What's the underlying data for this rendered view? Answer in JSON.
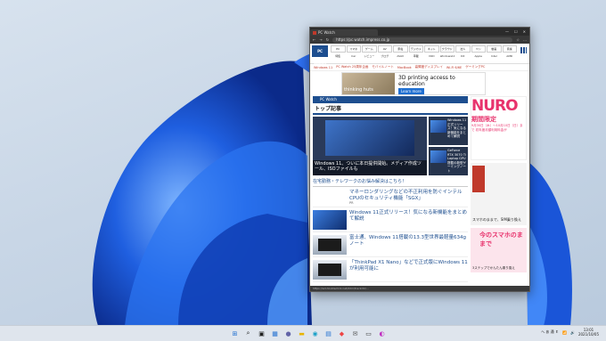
{
  "browser": {
    "tab_title": "PC Watch",
    "url": "https://pc.watch.impress.co.jp",
    "status_url": "https://ad.doubleclick.net/ddm/trackclk/…",
    "window_controls": [
      "—",
      "☐",
      "✕"
    ]
  },
  "site": {
    "logo": "PC Watch",
    "nav_top": [
      "PC",
      "スマホ",
      "ゲーム",
      "AV",
      "家電",
      "デジカメ",
      "ネット",
      "クラウド",
      "法人",
      "ペン",
      "動画",
      "音楽"
    ],
    "nav_sub": [
      "特集",
      "Car",
      "レビュー",
      "ブログ",
      "AVAV",
      "車載",
      "VOD",
      "Windows11",
      "DX",
      "Apple",
      "Intel",
      "AMD"
    ],
    "topics": [
      "Windows 11",
      "PC Watch 25周年企画",
      "モバイルノート",
      "MacBook",
      "高輝度ディスプレイ",
      "Wi-Fi 6/6E",
      "ゲーミングPC"
    ]
  },
  "ad": {
    "image_caption": "thinking huts",
    "headline": "3D printing access to education",
    "cta": "Learn more"
  },
  "main": {
    "clock_bar": "PC Watch",
    "section_title": "トップ記事",
    "hero_caption": "Windows 11、ついに本日提供開始。メディア作成ツール、ISOファイルも",
    "hero_side": [
      {
        "title": "Windows 11正式リリース！気になる新機能をまとめて解説"
      },
      {
        "title": "GeForce RTX 3070 Ti Laptop GPU搭載の新型ゲーミングノート"
      }
    ],
    "notice": "在宅勤務・テレワークのお悩み解決はこちら！",
    "items": [
      {
        "title": "マネーロンダリングなどの不正利用を防ぐインテルCPUのセキュリティ機能「SGX」",
        "sub": "PR"
      },
      {
        "title": "Windows 11正式リリース！気になる新機能をまとめて解説",
        "sub": ""
      },
      {
        "title": "富士通、Windows 11搭載の13.3型世界最軽量634gノート",
        "sub": ""
      },
      {
        "title": "「ThinkPad X1 Nano」などで正式版にWindows 11が利用可能に",
        "sub": ""
      }
    ]
  },
  "sidebar": {
    "nuro_title": "NURO",
    "nuro_promo": "期間限定",
    "nuro_note": "9月30日（木）〜10月10日（日）まで 初年度月額利用料金が",
    "ad2_text": "スマホのままで、SIM乗り換え",
    "ad3_title": "今のスマホのままで",
    "ad3_text": "3ステップでかんたん乗り換え"
  },
  "taskbar": {
    "time": "13:01",
    "date": "2021/10/05",
    "tray_text": "へ あ 通 Ｅ"
  },
  "colors": {
    "accent": "#1d4e8f",
    "nuro": "#e8336d",
    "taskbar": "#dfe5ed"
  }
}
